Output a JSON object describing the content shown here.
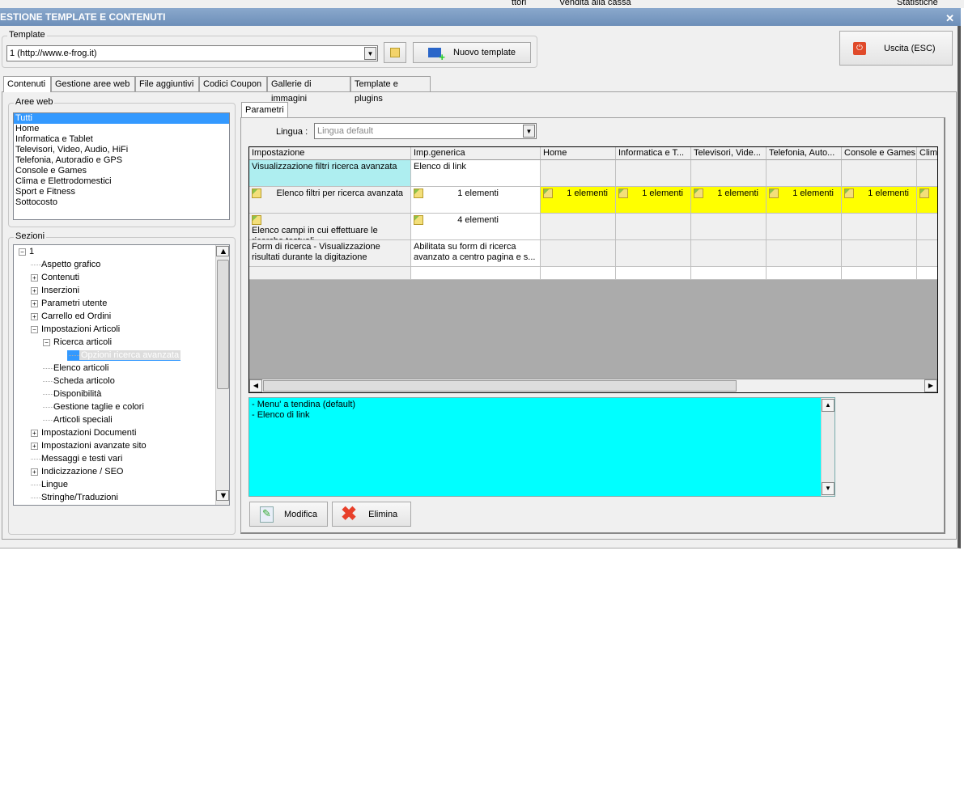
{
  "background_app": {
    "t1": "ttori",
    "t2": "Vendita alla cassa",
    "t3": "Statistiche"
  },
  "window": {
    "title": "ESTIONE TEMPLATE E CONTENUTI",
    "close": "✕"
  },
  "template": {
    "group_label": "Template",
    "value": "1 (http://www.e-frog.it)",
    "new_button": "Nuovo template"
  },
  "exit_button": "Uscita (ESC)",
  "tabs": [
    "Contenuti",
    "Gestione aree web",
    "File aggiuntivi",
    "Codici Coupon",
    "Gallerie di immagini",
    "Template e plugins"
  ],
  "aree_web": {
    "label": "Aree web",
    "items": [
      "Tutti",
      "Home",
      "Informatica e Tablet",
      "Televisori, Video, Audio, HiFi",
      "Telefonia, Autoradio e GPS",
      "Console e Games",
      "Clima e Elettrodomestici",
      "Sport e Fitness",
      "Sottocosto"
    ],
    "selected": 0
  },
  "sezioni": {
    "label": "Sezioni",
    "nodes": [
      {
        "label": "1",
        "level": 0,
        "toggle": "−"
      },
      {
        "label": "Aspetto grafico",
        "level": 1,
        "toggle": ""
      },
      {
        "label": "Contenuti",
        "level": 1,
        "toggle": "+"
      },
      {
        "label": "Inserzioni",
        "level": 1,
        "toggle": "+"
      },
      {
        "label": "Parametri utente",
        "level": 1,
        "toggle": "+"
      },
      {
        "label": "Carrello ed Ordini",
        "level": 1,
        "toggle": "+"
      },
      {
        "label": "Impostazioni Articoli",
        "level": 1,
        "toggle": "−"
      },
      {
        "label": "Ricerca articoli",
        "level": 2,
        "toggle": "−"
      },
      {
        "label": "Opzioni ricerca avanzata",
        "level": 3,
        "toggle": "",
        "selected": true
      },
      {
        "label": "Elenco articoli",
        "level": 2,
        "toggle": ""
      },
      {
        "label": "Scheda articolo",
        "level": 2,
        "toggle": ""
      },
      {
        "label": "Disponibilità",
        "level": 2,
        "toggle": ""
      },
      {
        "label": "Gestione taglie e colori",
        "level": 2,
        "toggle": ""
      },
      {
        "label": "Articoli speciali",
        "level": 2,
        "toggle": ""
      },
      {
        "label": "Impostazioni Documenti",
        "level": 1,
        "toggle": "+"
      },
      {
        "label": "Impostazioni avanzate sito",
        "level": 1,
        "toggle": "+"
      },
      {
        "label": "Messaggi e testi vari",
        "level": 1,
        "toggle": ""
      },
      {
        "label": "Indicizzazione / SEO",
        "level": 1,
        "toggle": "+"
      },
      {
        "label": "Lingue",
        "level": 1,
        "toggle": ""
      },
      {
        "label": "Stringhe/Traduzioni",
        "level": 1,
        "toggle": ""
      }
    ]
  },
  "parametri": {
    "tab": "Parametri",
    "lingua_label": "Lingua :",
    "lingua_value": "Lingua default"
  },
  "grid": {
    "columns": [
      "Impostazione",
      "Imp.generica",
      "Home",
      "Informatica e T...",
      "Televisori, Vide...",
      "Telefonia, Auto...",
      "Console e Games",
      "Clima"
    ],
    "rows": [
      {
        "cells": [
          "Visualizzazione filtri ricerca avanzata",
          "Elenco di link",
          "",
          "",
          "",
          "",
          "",
          ""
        ],
        "first_bg": "#aeeef0"
      },
      {
        "cells": [
          "Elenco filtri per ricerca avanzata",
          "1 elementi",
          "1 elementi",
          "1 elementi",
          "1 elementi",
          "1 elementi",
          "1 elementi",
          ""
        ],
        "icons": true,
        "highlight": "#ffff00"
      },
      {
        "cells": [
          "Elenco campi in cui effettuare le ricerche testuali",
          "4 elementi",
          "",
          "",
          "",
          "",
          "",
          ""
        ],
        "icons": true
      },
      {
        "cells": [
          "Form di ricerca - Visualizzazione risultati durante la digitazione",
          "Abilitata su form di ricerca avanzato a centro pagina e s...",
          "",
          "",
          "",
          "",
          "",
          ""
        ]
      },
      {
        "cells": [
          "",
          "",
          "",
          "",
          "",
          "",
          "",
          ""
        ]
      }
    ]
  },
  "description": [
    "- Menu' a tendina (default)",
    "- Elenco di link"
  ],
  "buttons": {
    "edit": "Modifica",
    "delete": "Elimina"
  },
  "colors": {
    "description_bg": "#00ffff",
    "highlight": "#ffff00",
    "selection": "#3399ff"
  }
}
